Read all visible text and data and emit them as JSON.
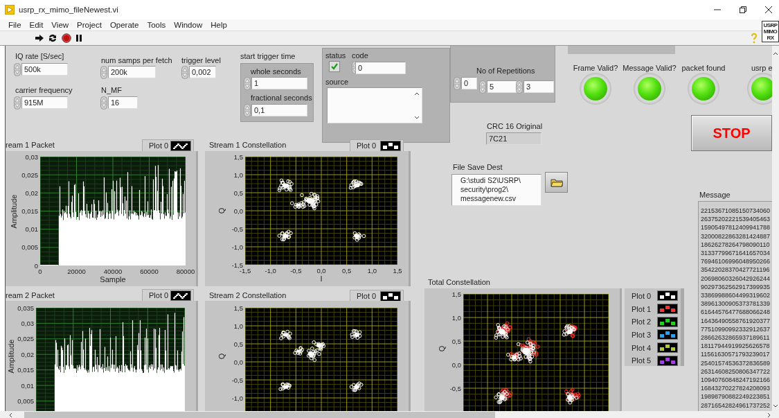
{
  "window": {
    "title": "usrp_rx_mimo_fileNewest.vi"
  },
  "menu": [
    "File",
    "Edit",
    "View",
    "Project",
    "Operate",
    "Tools",
    "Window",
    "Help"
  ],
  "vi_icon": {
    "lines": [
      "USRP",
      "MIMO",
      "RX"
    ]
  },
  "controls": [
    {
      "label": "IQ rate [S/sec]",
      "value": "500k"
    },
    {
      "label": "carrier frequency",
      "value": "915M"
    },
    {
      "label": "num samps per fetch",
      "value": "200k"
    },
    {
      "label": "N_MF",
      "value": "16"
    },
    {
      "label": "trigger level",
      "value": "0,002"
    }
  ],
  "start_trigger_time": {
    "label": "start trigger time",
    "fields": [
      {
        "label": "whole seconds",
        "value": "1"
      },
      {
        "label": "fractional seconds",
        "value": "0,1"
      }
    ]
  },
  "error_cluster": {
    "status_label": "status",
    "status": true,
    "code_label": "code",
    "code": "0",
    "source_label": "source"
  },
  "repetitions": {
    "label": "No of Repetitions",
    "values": [
      "0",
      "5",
      "3"
    ]
  },
  "leds": [
    {
      "label": "Frame Valid?",
      "on": true
    },
    {
      "label": "Message Valid?",
      "on": true
    },
    {
      "label": "packet found",
      "on": true
    },
    {
      "label": "usrp e",
      "on": true
    }
  ],
  "stop_button": {
    "label": "STOP"
  },
  "crc": {
    "label": "CRC 16 Original",
    "value": "7C21"
  },
  "file_save_dest": {
    "label": "File Save Dest",
    "path": [
      "G:\\studi S2\\USRP\\",
      "security\\prog2\\",
      "messagenew.csv"
    ]
  },
  "message": {
    "label": "Message",
    "lines": [
      "22153671085150734060",
      "26375202221539405463",
      "15905497812409941788",
      "32000822863281424887",
      "18626278264798090110",
      "31337799671641657034",
      "76946106996048950266",
      "35422028370427721196",
      "20698060326042926244",
      "90297362562917399935",
      "33869988604499319602",
      "38961300905373781339",
      "61644576477688066248",
      "16436490558761920377",
      "77510990992332912637",
      "28662632865937189611",
      "18117944919925626578",
      "11561630571793239017",
      "25401574536372836589",
      "26314608250806347722",
      "10940760848247192166",
      "16843270227824208093",
      "19898790882249223851",
      "28716542824961737252"
    ]
  },
  "graphs": [
    {
      "kind": "waveform",
      "title": "ream 1 Packet",
      "legend": [
        {
          "name": "Plot 0",
          "color": "#ffffff"
        }
      ],
      "ylabel": "Amplitude",
      "xlabel": "Sample",
      "yticks": [
        "0,03",
        "0,025",
        "0,02",
        "0,015",
        "0,01",
        "0,005",
        "0"
      ],
      "xticks": [
        "0",
        "20000",
        "40000",
        "60000",
        "80000"
      ]
    },
    {
      "kind": "constellation",
      "title": "Stream 1 Constellation",
      "legend": [
        {
          "name": "Plot 0",
          "color": "#ffffff"
        }
      ],
      "ylabel": "Q",
      "xlabel": "I",
      "yticks": [
        "1,5",
        "1,0",
        "0,5",
        "0,0",
        "-0,5",
        "-1,0",
        "-1,5"
      ],
      "xticks": [
        "-1,5",
        "-1,0",
        "-0,5",
        "0,0",
        "0,5",
        "1,0",
        "1,5"
      ]
    },
    {
      "kind": "waveform",
      "title": "ream 2 Packet",
      "legend": [
        {
          "name": "Plot 0",
          "color": "#ffffff"
        }
      ],
      "ylabel": "Amplitude",
      "yticks": [
        "0,035",
        "0,03",
        "0,025",
        "0,02",
        "0,015",
        "0,01",
        "0,005"
      ]
    },
    {
      "kind": "constellation",
      "title": "Stream 2 Constellation",
      "legend": [
        {
          "name": "Plot 0",
          "color": "#ffffff"
        }
      ],
      "ylabel": "Q",
      "yticks": [
        "1,5",
        "1,0",
        "0,5",
        "0,0",
        "-0,5",
        "-1,0"
      ]
    },
    {
      "kind": "multi_constellation",
      "title": "Total Constellation",
      "legend": [
        {
          "name": "Plot 0",
          "color": "#ffffff"
        },
        {
          "name": "Plot 1",
          "color": "#ff3030"
        },
        {
          "name": "Plot 2",
          "color": "#20d020"
        },
        {
          "name": "Plot 3",
          "color": "#30a0e0"
        },
        {
          "name": "Plot 4",
          "color": "#b0d030"
        },
        {
          "name": "Plot 5",
          "color": "#a040e0"
        }
      ],
      "ylabel": "Q",
      "yticks": [
        "1,5",
        "1,0",
        "0,5",
        "0,0",
        "-0,5"
      ]
    }
  ]
}
